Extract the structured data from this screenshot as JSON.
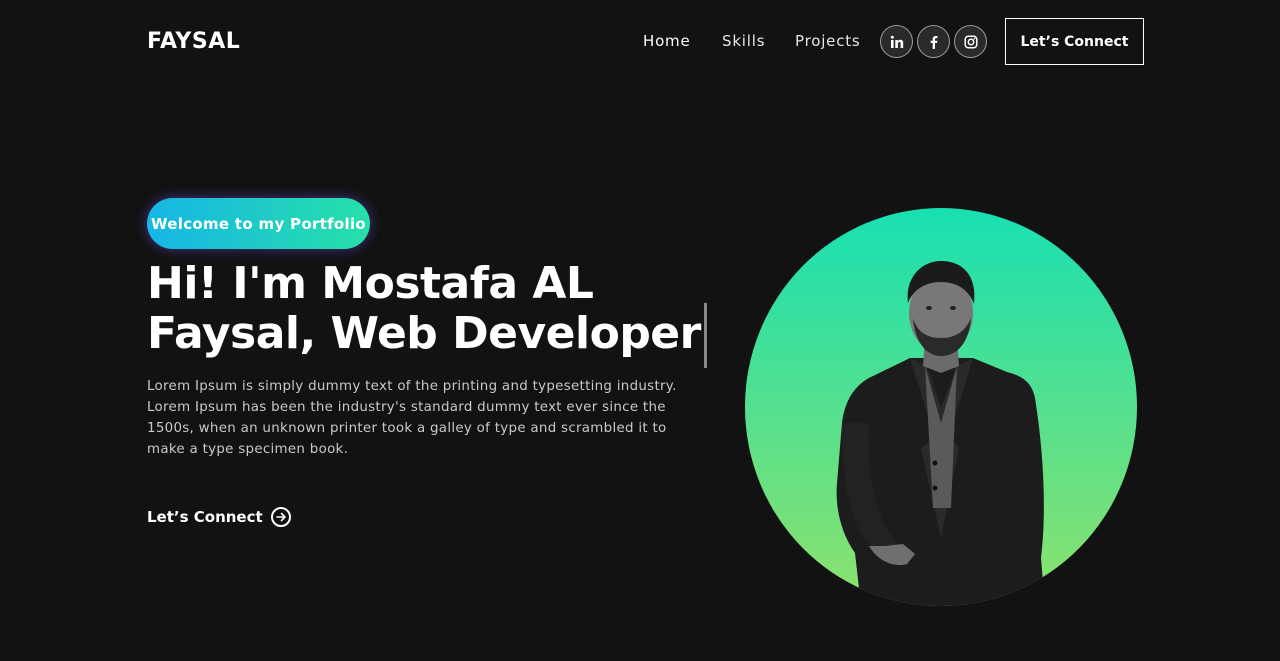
{
  "brand": {
    "logo": "FAYSAL"
  },
  "nav": {
    "links": [
      "Home",
      "Skills",
      "Projects"
    ],
    "social_icons": [
      "linkedin-icon",
      "facebook-icon",
      "instagram-icon"
    ],
    "cta_label": "Let’s Connect"
  },
  "hero": {
    "tagline": "Welcome to my Portfolio",
    "headline_line1": "Hi! I'm Mostafa AL",
    "headline_line2": "Faysal, Web Developer",
    "intro": "Lorem Ipsum is simply dummy text of the printing and typesetting industry. Lorem Ipsum has been the industry's standard dummy text ever since the 1500s, when an unknown printer took a galley of type and scrambled it to make a type specimen book.",
    "cta_label": "Let’s Connect",
    "cta_icon": "arrow-right-circle-icon"
  },
  "colors": {
    "background": "#121212",
    "gradient_start": "#16b6e6",
    "gradient_end": "#27e0a8",
    "circle_top": "#18e0b2",
    "circle_bottom": "#8ee26c"
  }
}
